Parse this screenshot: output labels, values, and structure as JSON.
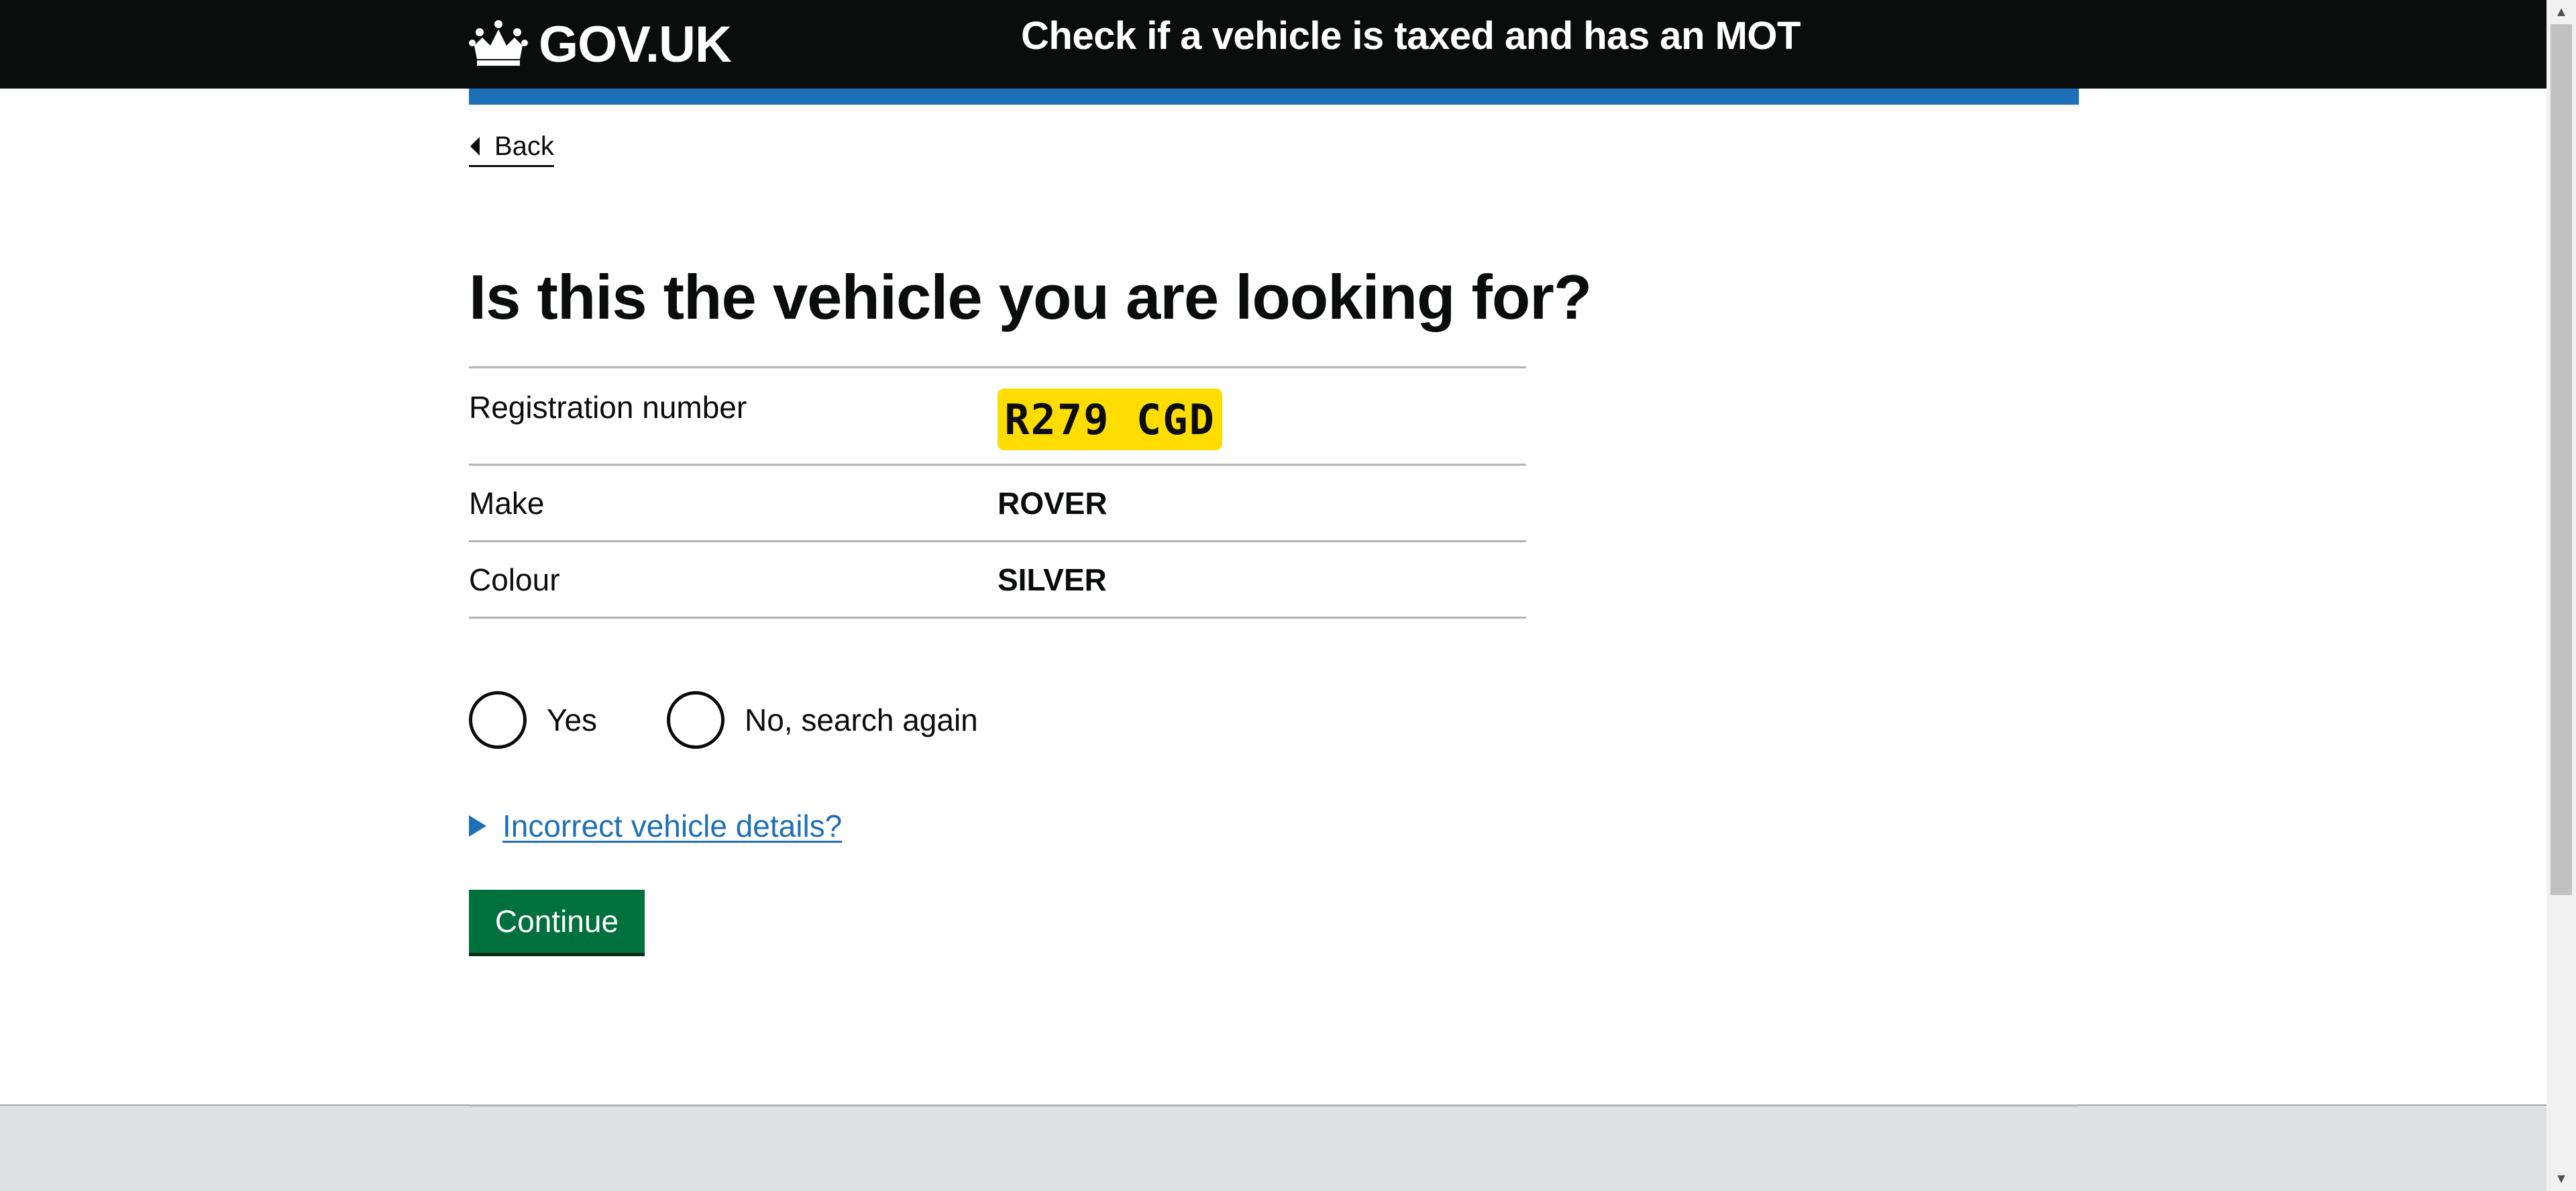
{
  "header": {
    "logo_text": "GOV.UK",
    "service_name": "Check if a vehicle is taxed and has an MOT"
  },
  "nav": {
    "back_label": "Back"
  },
  "main": {
    "title": "Is this the vehicle you are looking for?",
    "summary": {
      "registration_label": "Registration number",
      "registration_value": "R279 CGD",
      "make_label": "Make",
      "make_value": "ROVER",
      "colour_label": "Colour",
      "colour_value": "SILVER"
    },
    "radios": {
      "yes_label": "Yes",
      "no_label": "No, search again"
    },
    "details_summary": "Incorrect vehicle details?",
    "continue_label": "Continue"
  },
  "colors": {
    "header_bg": "#0b0c0c",
    "brand_blue": "#1d70b8",
    "plate_yellow": "#ffdd00",
    "button_green": "#00703c",
    "footer_bg": "#dfe0e1"
  },
  "icons": {
    "logo": "crown-icon",
    "back": "triangle-left-icon",
    "details": "triangle-right-icon"
  }
}
